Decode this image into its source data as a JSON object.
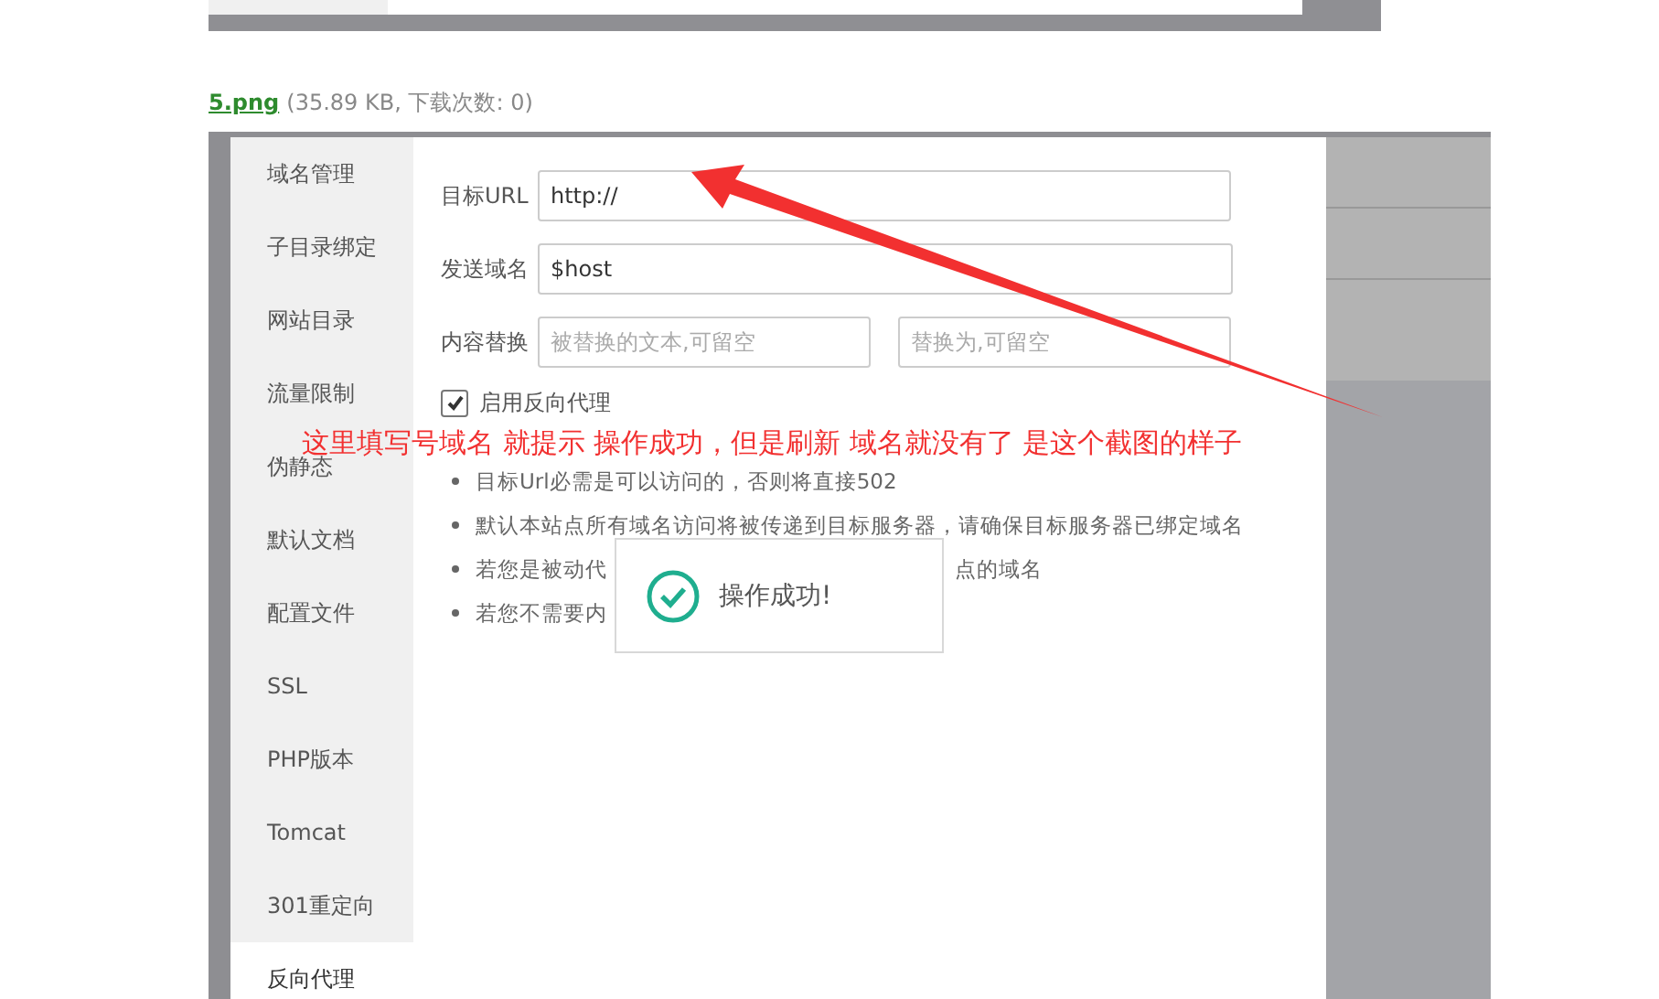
{
  "attachment": {
    "file": "5.png",
    "meta": "(35.89 KB, 下载次数: 0)"
  },
  "sidebar": {
    "items": [
      {
        "label": "域名管理",
        "selected": false
      },
      {
        "label": "子目录绑定",
        "selected": false
      },
      {
        "label": "网站目录",
        "selected": false
      },
      {
        "label": "流量限制",
        "selected": false
      },
      {
        "label": "伪静态",
        "selected": false
      },
      {
        "label": "默认文档",
        "selected": false
      },
      {
        "label": "配置文件",
        "selected": false
      },
      {
        "label": "SSL",
        "selected": false
      },
      {
        "label": "PHP版本",
        "selected": false
      },
      {
        "label": "Tomcat",
        "selected": false
      },
      {
        "label": "301重定向",
        "selected": false
      },
      {
        "label": "反向代理",
        "selected": true
      }
    ]
  },
  "form": {
    "fields": [
      {
        "label": "目标URL",
        "inputs": [
          {
            "value": "http://"
          }
        ]
      },
      {
        "label": "发送域名",
        "inputs": [
          {
            "value": "$host"
          }
        ]
      },
      {
        "label": "内容替换",
        "inputs": [
          {
            "placeholder": "被替换的文本,可留空"
          },
          {
            "placeholder": "替换为,可留空"
          }
        ]
      }
    ],
    "proxy": {
      "label": "启用反向代理",
      "checked": true
    }
  },
  "notes": [
    {
      "text": "目标Url必需是可以访问的，否则将直接502"
    },
    {
      "text": "默认本站点所有域名访问将被传递到目标服务器，请确保目标服务器已绑定域名"
    },
    {
      "text": "若您是被动代",
      "text_after": "点的域名"
    },
    {
      "text": "若您不需要内"
    }
  ],
  "toast": {
    "message": "操作成功!"
  },
  "annotation": {
    "text": "这里填写号域名  就提示 操作成功，但是刷新 域名就没有了 是这个截图的样子"
  }
}
